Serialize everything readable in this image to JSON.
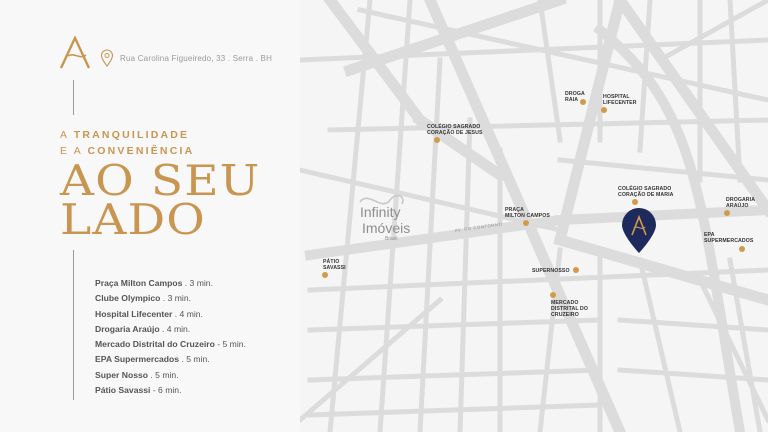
{
  "brand": {
    "logo_letter": "A",
    "accent": "#c89650",
    "dot_color": "#d29a4a",
    "pin_color": "#1e2a5c"
  },
  "address": {
    "text": "Rua Carolina Figueiredo, 33  .  Serra  .  BH",
    "icon": "location-pin-icon"
  },
  "tagline": {
    "line1_thin": "A ",
    "line1_bold": "TRANQUILIDADE",
    "line2_thin": "E A ",
    "line2_bold": "CONVENIÊNCIA"
  },
  "headline": {
    "line1": "AO SEU",
    "line2": "LADO"
  },
  "distances": [
    {
      "place": "Praça Milton Campos",
      "time": ". 3 min."
    },
    {
      "place": "Clube Olympico",
      "time": ". 3 min."
    },
    {
      "place": "Hospital Lifecenter",
      "time": ". 4 min."
    },
    {
      "place": "Drogaria Araújo",
      "time": ". 4 min."
    },
    {
      "place": "Mercado Distrital do Cruzeiro",
      "time": "- 5 min."
    },
    {
      "place": "EPA Supermercados",
      "time": ". 5 min."
    },
    {
      "place": "Super Nosso",
      "time": ". 5 min."
    },
    {
      "place": "Pátio Savassi",
      "time": "- 6 min."
    }
  ],
  "map": {
    "labels": {
      "drogaria_raia": "DROGA\nRAIA",
      "hospital": "HOSPITAL\nLIFECENTER",
      "sagrado_jesus": "COLÉGIO SAGRADO\nCORAÇÃO DE JESUS",
      "sagrado_maria": "COLÉGIO SAGRADO\nCORAÇÃO DE MARIA",
      "drogaria_araujo": "DROGARIA\nARAÚJO",
      "epa": "EPA\nSUPERMERCADOS",
      "praca": "PRAÇA\nMILTON CAMPOS",
      "supernosso": "SUPERNOSSO",
      "mercado": "MERCADO\nDISTRITAL DO\nCRUZEIRO",
      "patio": "PÁTIO\nSAVASSI"
    },
    "infinity": {
      "top": "Infinity",
      "bottom": "Imóveis",
      "sub": "Brasil"
    },
    "streets": {
      "contorno": "AV. DO CONTORNO"
    }
  }
}
